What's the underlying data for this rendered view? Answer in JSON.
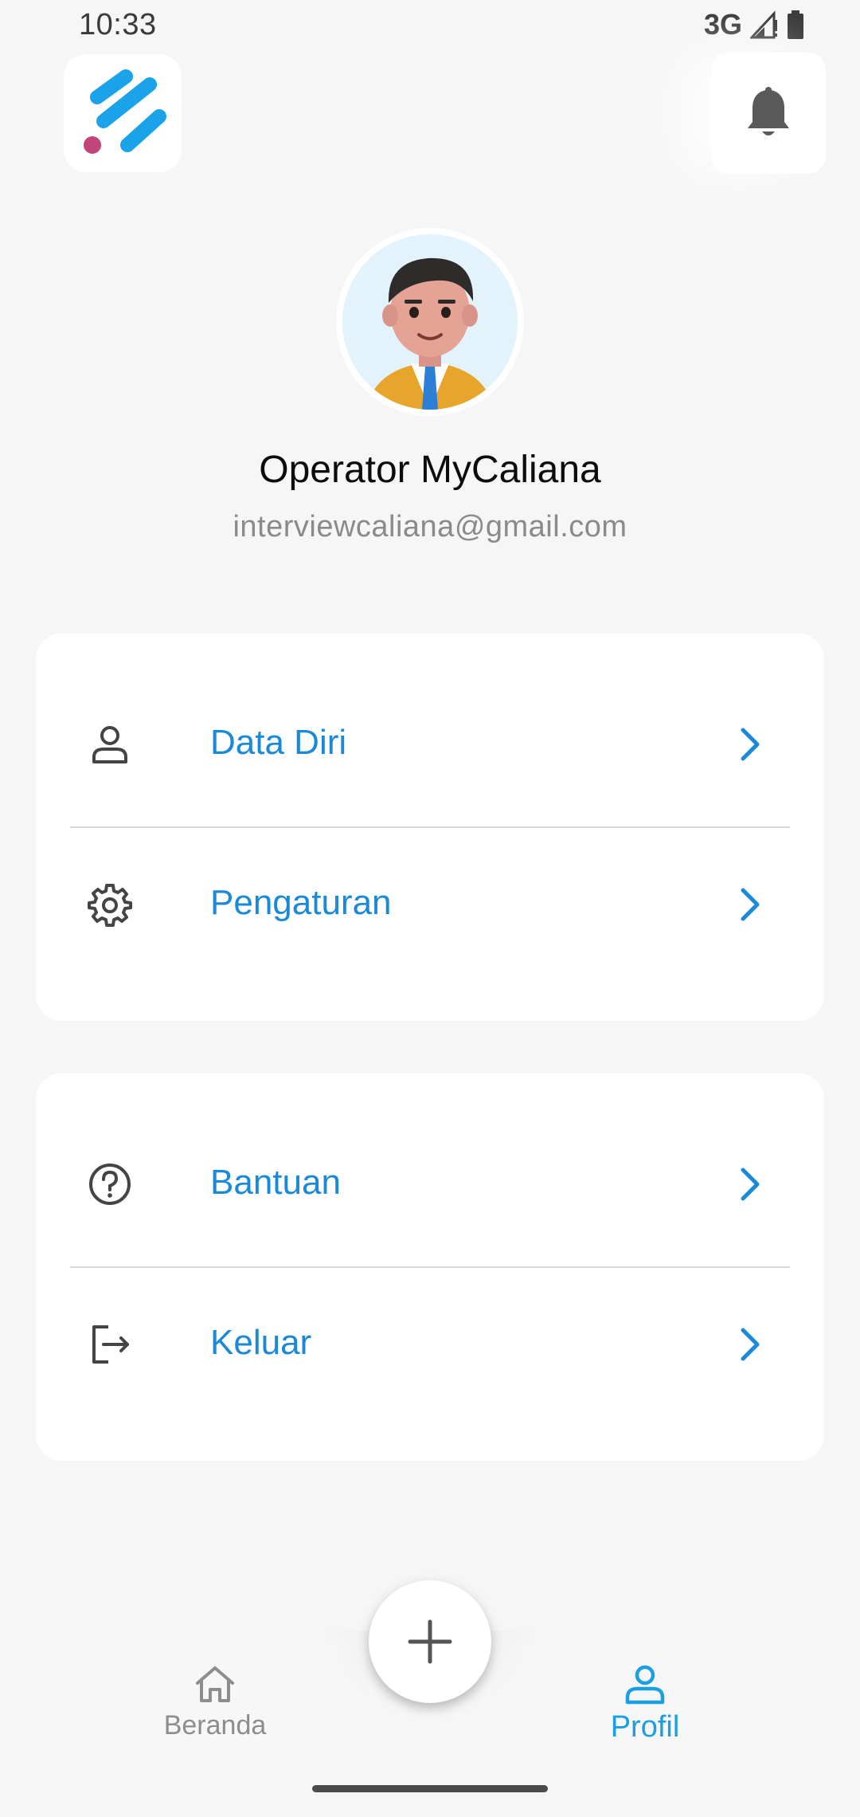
{
  "status_bar": {
    "time": "10:33",
    "network": "3G",
    "icons": [
      "signal-icon",
      "battery-icon"
    ]
  },
  "header": {
    "logo_icon": "app-logo-icon",
    "notification_icon": "bell-icon"
  },
  "profile": {
    "name": "Operator MyCaliana",
    "email": "interviewcaliana@gmail.com",
    "avatar_icon": "avatar-illustration"
  },
  "menu_groups": [
    {
      "items": [
        {
          "label": "Data Diri",
          "icon": "person-icon"
        },
        {
          "label": "Pengaturan",
          "icon": "gear-icon"
        }
      ]
    },
    {
      "items": [
        {
          "label": "Bantuan",
          "icon": "help-circle-icon"
        },
        {
          "label": "Keluar",
          "icon": "logout-icon"
        }
      ]
    }
  ],
  "bottom_nav": {
    "items": [
      {
        "label": "Beranda",
        "icon": "home-icon",
        "active": false
      },
      {
        "label": "Profil",
        "icon": "person-icon",
        "active": true
      }
    ],
    "fab_icon": "plus-icon"
  },
  "colors": {
    "accent": "#1a8ad8",
    "nav_active": "#1aa0e0",
    "nav_inactive": "#8d8d8d",
    "background": "#f6f6f6",
    "logo_blue": "#1aa3e8",
    "logo_pink": "#c2457a"
  }
}
